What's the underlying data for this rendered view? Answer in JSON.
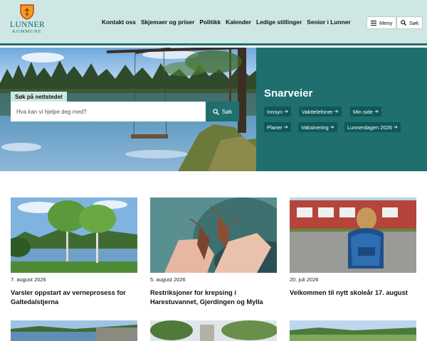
{
  "header": {
    "logo_name": "LUNNER",
    "logo_sub": "KOMMUNE",
    "nav": [
      "Kontakt oss",
      "Skjemaer og priser",
      "Politikk",
      "Kalender",
      "Ledige stillinger",
      "Senior i Lunner"
    ],
    "menu_label": "Meny",
    "search_label": "Søk"
  },
  "hero": {
    "search_heading": "Søk på nettstedet",
    "search_placeholder": "Hva kan vi hjelpe deg med?",
    "search_button": "Søk"
  },
  "shortcuts": {
    "title": "Snarveier",
    "items": [
      "Innsyn",
      "Vakttelefoner",
      "Min side",
      "Planer",
      "Vaksinering",
      "Lunnerdagen 2026"
    ]
  },
  "news": [
    {
      "date": "7. august 2026",
      "title": "Varsler oppstart av verneprosess for Galtedalstjerna"
    },
    {
      "date": "5. august 2026",
      "title": "Restriksjoner for krepsing i Harestuvannet, Gjerdingen og Mylla"
    },
    {
      "date": "20. juli 2026",
      "title": "Velkommen til nytt skoleår 17. august"
    }
  ],
  "colors": {
    "accent": "#1f6f6f",
    "header_bg": "#cfe7e4",
    "chip_bg": "#0f5858"
  },
  "icons": [
    "coat-of-arms",
    "hamburger-icon",
    "search-icon",
    "arrow-right-icon"
  ]
}
